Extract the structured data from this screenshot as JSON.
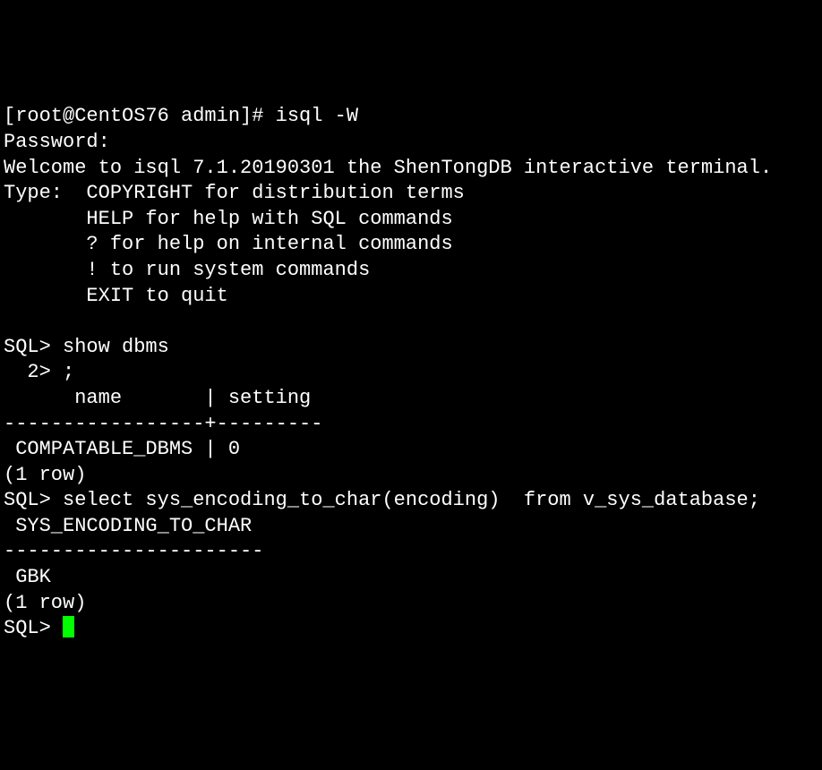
{
  "lines": [
    "[root@CentOS76 admin]# isql -W",
    "Password:",
    "Welcome to isql 7.1.20190301 the ShenTongDB interactive terminal.",
    "Type:  COPYRIGHT for distribution terms",
    "       HELP for help with SQL commands",
    "       ? for help on internal commands",
    "       ! to run system commands",
    "       EXIT to quit",
    "",
    "SQL> show dbms",
    "  2> ;",
    "      name       | setting ",
    "-----------------+---------",
    " COMPATABLE_DBMS | 0",
    "(1 row)",
    "SQL> select sys_encoding_to_char(encoding)  from v_sys_database;",
    " SYS_ENCODING_TO_CHAR ",
    "----------------------",
    " GBK",
    "(1 row)",
    "SQL> "
  ],
  "prompt_final": "SQL> "
}
